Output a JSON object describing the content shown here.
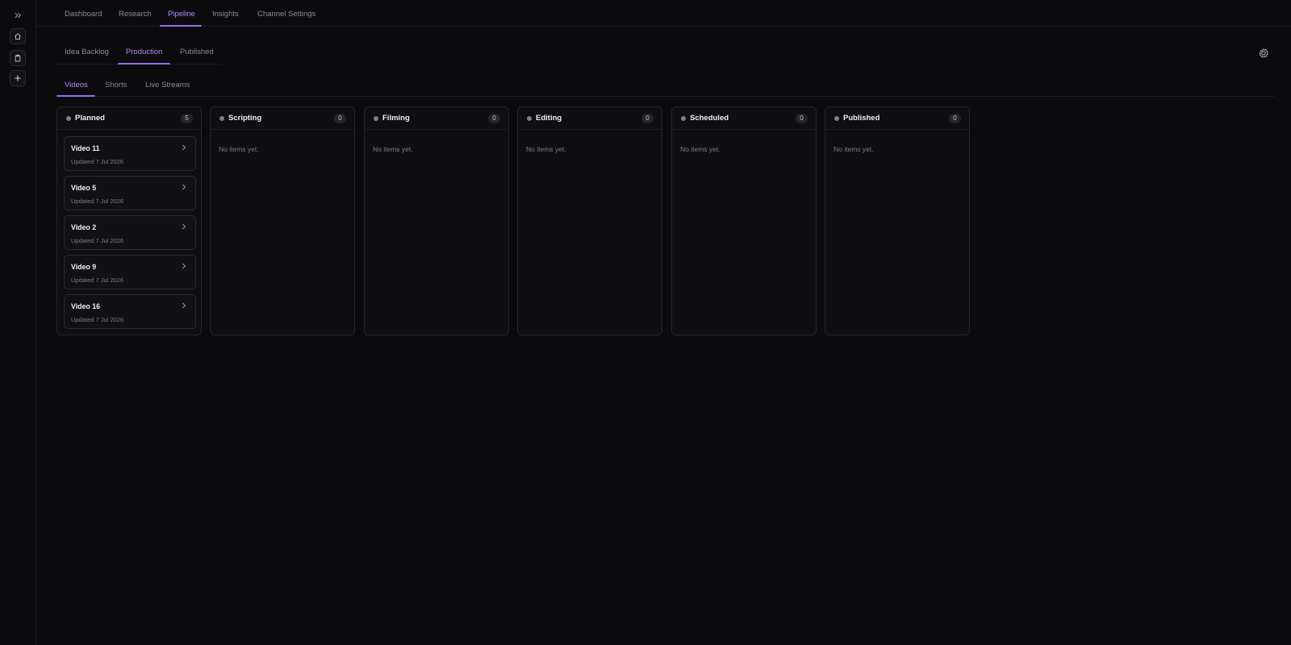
{
  "top_nav": {
    "items": [
      "Dashboard",
      "Research",
      "Pipeline",
      "Insights",
      "Channel Settings"
    ],
    "active": "Pipeline"
  },
  "pipeline_tabs": {
    "items": [
      "Idea Backlog",
      "Production",
      "Published"
    ],
    "active": "Production"
  },
  "view_tabs": {
    "items": [
      "Videos",
      "Shorts",
      "Live Streams"
    ],
    "active": "Videos"
  },
  "columns": [
    {
      "title": "Planned",
      "count": "5",
      "cards": [
        {
          "title": "Video 11",
          "updated": "Updated 7 Jul 2026"
        },
        {
          "title": "Video 5",
          "updated": "Updated 7 Jul 2026"
        },
        {
          "title": "Video 2",
          "updated": "Updated 7 Jul 2026"
        },
        {
          "title": "Video 9",
          "updated": "Updated 7 Jul 2026"
        },
        {
          "title": "Video 16",
          "updated": "Updated 7 Jul 2026"
        }
      ]
    },
    {
      "title": "Scripting",
      "count": "0",
      "empty_text": "No items yet."
    },
    {
      "title": "Filming",
      "count": "0",
      "empty_text": "No items yet."
    },
    {
      "title": "Editing",
      "count": "0",
      "empty_text": "No items yet."
    },
    {
      "title": "Scheduled",
      "count": "0",
      "empty_text": "No items yet."
    },
    {
      "title": "Published",
      "count": "0",
      "empty_text": "No items yet."
    }
  ],
  "icons": {
    "rail": [
      "expand-sidebar-icon",
      "home-icon",
      "clipboard-icon",
      "plus-icon"
    ],
    "settings": "gear-icon",
    "card": "chevron-right-icon"
  },
  "colors": {
    "accent": "#9a6cf0",
    "accent_text": "#b18cf4",
    "background": "#0b0b0d",
    "status_dot": "#7e7e86"
  }
}
